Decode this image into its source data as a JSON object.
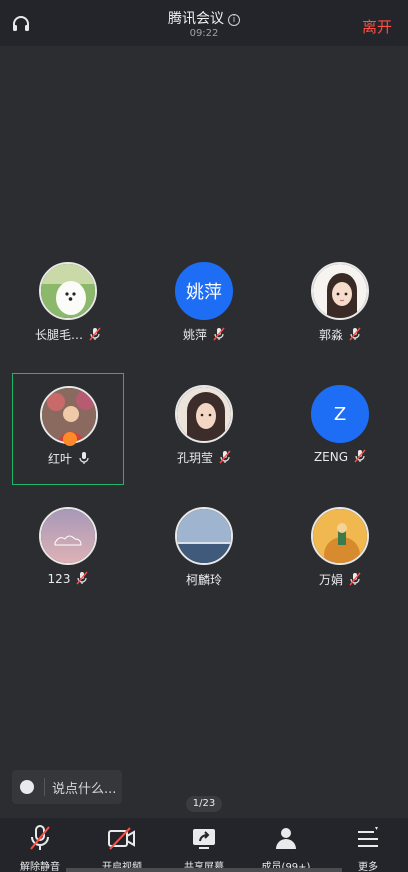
{
  "header": {
    "title": "腾讯会议",
    "time": "09:22",
    "leave_label": "离开"
  },
  "participants": [
    {
      "name": "长腿毛…",
      "avatar_text": "",
      "mic": "muted"
    },
    {
      "name": "姚萍",
      "avatar_text": "姚萍",
      "mic": "muted"
    },
    {
      "name": "郭淼",
      "avatar_text": "",
      "mic": "muted"
    },
    {
      "name": "红叶",
      "avatar_text": "",
      "mic": "on"
    },
    {
      "name": "孔玥莹",
      "avatar_text": "",
      "mic": "muted"
    },
    {
      "name": "ZENG",
      "avatar_text": "Z",
      "mic": "muted"
    },
    {
      "name": "123",
      "avatar_text": "",
      "mic": "muted"
    },
    {
      "name": "柯麟玲",
      "avatar_text": "",
      "mic": "none"
    },
    {
      "name": "万娟",
      "avatar_text": "",
      "mic": "muted"
    }
  ],
  "chat": {
    "placeholder": "说点什么..."
  },
  "page_indicator": "1/23",
  "toolbar": {
    "unmute": "解除静音",
    "video": "开启视频",
    "share": "共享屏幕",
    "members": "成员(99+)",
    "more": "更多"
  },
  "colors": {
    "accent_red": "#ff4f45",
    "avatar_blue": "#1e6df5",
    "active_border": "#1fb66b"
  }
}
